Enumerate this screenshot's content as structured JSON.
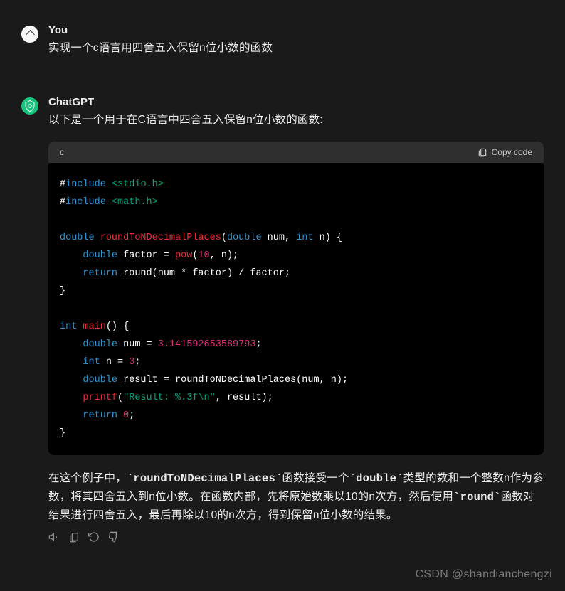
{
  "user": {
    "author": "You",
    "text": "实现一个c语言用四舍五入保留n位小数的函数"
  },
  "assistant": {
    "author": "ChatGPT",
    "intro": "以下是一个用于在C语言中四舍五入保留n位小数的函数:",
    "code": {
      "language": "c",
      "copy_label": "Copy code",
      "tokens": {
        "include1_kw": "include",
        "include1_str": "<stdio.h>",
        "include2_kw": "include",
        "include2_str": "<math.h>",
        "type_double1": "double",
        "fn_roundTo": "roundToNDecimalPlaces",
        "type_double2": "double",
        "param_num": " num, ",
        "type_int1": "int",
        "param_n": " n) {",
        "type_double3": "double",
        "var_factor": " factor = ",
        "fn_pow": "pow",
        "num_10": "10",
        "kw_return1": "return",
        "fn_round": " round(num * factor) / factor;",
        "type_int2": "int",
        "fn_main": "main",
        "type_double4": "double",
        "var_num": " num = ",
        "num_pi": "3.141592653589793",
        "type_int3": "int",
        "var_n": " n = ",
        "num_3": "3",
        "type_double5": "double",
        "var_result": " result = roundToNDecimalPlaces(num, n);",
        "fn_printf": "printf",
        "str_fmt": "\"Result: %.3f\\n\"",
        "printf_args": ", result);",
        "kw_return2": "return",
        "num_0": "0"
      }
    },
    "explanation_parts": {
      "p1": "在这个例子中，",
      "code1": "`roundToNDecimalPlaces`",
      "p2": "函数接受一个",
      "code2": "`double`",
      "p3": "类型的数和一个整数n作为参数，将其四舍五入到n位小数。在函数内部，先将原始数乘以10的n次方，然后使用",
      "code3": "`round`",
      "p4": "函数对结果进行四舍五入，最后再除以10的n次方，得到保留n位小数的结果。"
    }
  },
  "watermark": "CSDN @shandianchengzi"
}
